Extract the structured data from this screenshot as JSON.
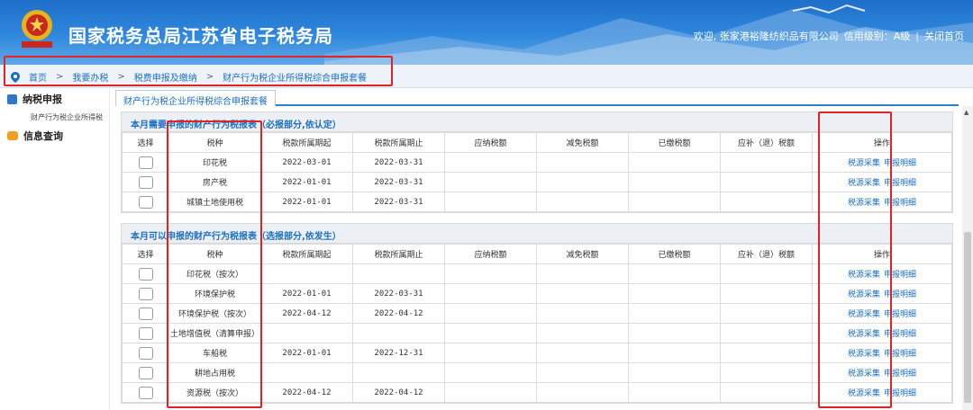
{
  "header": {
    "title": "国家税务总局江苏省电子税务局",
    "welcome": "欢迎, 张家港裕隆纺织品有限公司",
    "credit": "信用级别：A级",
    "separator": "|",
    "close": "关闭首页"
  },
  "breadcrumb": {
    "items": [
      "首页",
      "我要办税",
      "税费申报及缴纳",
      "财产行为税企业所得税综合申报套餐"
    ],
    "arrow": ">"
  },
  "sidebar": {
    "group1": "纳税申报",
    "sub1": "财产行为税企业所得税",
    "group2": "信息查询"
  },
  "tab": {
    "label": "财产行为税企业所得税综合申报套餐"
  },
  "columns": [
    "选择",
    "税种",
    "税款所属期起",
    "税款所属期止",
    "应纳税额",
    "减免税额",
    "已缴税额",
    "应补（退）税额",
    "操作"
  ],
  "actions": {
    "collect": "税源采集",
    "detail": "申报明细"
  },
  "section1": {
    "title": "本月需要申报的财产行为税报表（必报部分,依认定）",
    "rows": [
      {
        "name": "印花税",
        "start": "2022-03-01",
        "end": "2022-03-31"
      },
      {
        "name": "房产税",
        "start": "2022-01-01",
        "end": "2022-03-31"
      },
      {
        "name": "城镇土地使用税",
        "start": "2022-01-01",
        "end": "2022-03-31"
      }
    ]
  },
  "section2": {
    "title": "本月可以申报的财产行为税报表（选报部分,依发生）",
    "rows": [
      {
        "name": "印花税（按次）",
        "start": "",
        "end": ""
      },
      {
        "name": "环境保护税",
        "start": "2022-01-01",
        "end": "2022-03-31"
      },
      {
        "name": "环境保护税（按次）",
        "start": "2022-04-12",
        "end": "2022-04-12"
      },
      {
        "name": "土地增值税（清算申报）",
        "start": "",
        "end": ""
      },
      {
        "name": "车船税",
        "start": "2022-01-01",
        "end": "2022-12-31"
      },
      {
        "name": "耕地占用税",
        "start": "",
        "end": ""
      },
      {
        "name": "资源税（按次）",
        "start": "2022-04-12",
        "end": "2022-04-12"
      }
    ]
  }
}
